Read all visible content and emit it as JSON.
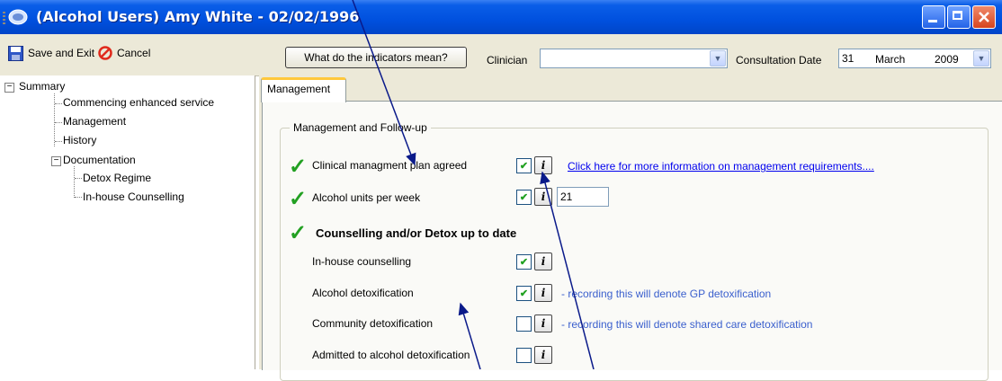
{
  "window": {
    "title": "(Alcohol Users) Amy White - 02/02/1996",
    "app_icon": "app-logo-icon",
    "controls": [
      "minimize-icon",
      "maximize-icon",
      "close-icon"
    ]
  },
  "toolbar": {
    "save_label": "Save and Exit",
    "cancel_label": "Cancel",
    "indicators_button": "What do the indicators mean?",
    "clinician_label": "Clinician",
    "clinician_value": "",
    "consultation_date_label": "Consultation Date",
    "date": {
      "day": "31",
      "month": "March",
      "year": "2009"
    }
  },
  "tree": {
    "root": "Summary",
    "items": [
      "Commencing enhanced service",
      "Management",
      "History",
      "Documentation"
    ],
    "documentation_children": [
      "Detox Regime",
      "In-house Counselling"
    ]
  },
  "tab": {
    "label": "Management"
  },
  "group": {
    "title": "Management and Follow-up",
    "rows": [
      {
        "label": "Clinical managment plan agreed",
        "checked": true,
        "indicator": "green-tick"
      },
      {
        "label": "Alcohol units per week",
        "checked": true,
        "indicator": "green-tick",
        "value": "21"
      },
      {
        "label": "Counselling and/or Detox up to date",
        "indicator": "green-tick"
      },
      {
        "label": "In-house counselling",
        "checked": true
      },
      {
        "label": "Alcohol detoxification",
        "checked": true,
        "note": "- recording this will denote GP detoxification"
      },
      {
        "label": "Community detoxification",
        "checked": false,
        "note": "- recording this will denote shared care detoxification"
      },
      {
        "label": "Admitted to alcohol detoxification",
        "checked": false
      }
    ],
    "link": "Click here for more information on management requirements....",
    "info_glyph": "i",
    "check_glyph": "✔",
    "tick_glyph": "✓"
  },
  "colors": {
    "titlebar": "#0050de",
    "accent_tick": "#22a022",
    "note_text": "#3a5fcd",
    "link": "#0000ee"
  }
}
